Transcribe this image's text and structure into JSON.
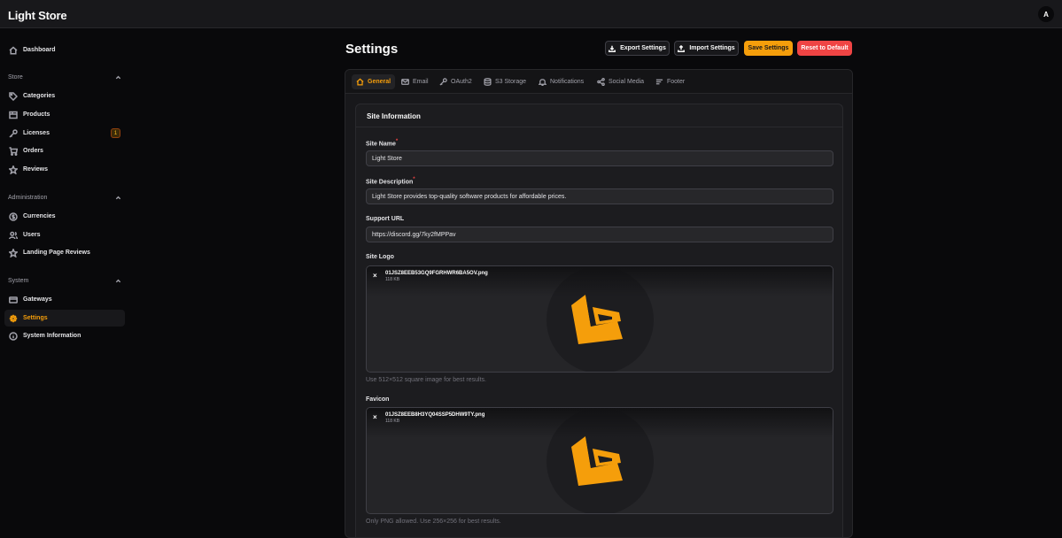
{
  "app": {
    "title": "Light Store",
    "avatar_initial": "A"
  },
  "sidebar": {
    "dashboard": "Dashboard",
    "groups": {
      "store": "Store",
      "administration": "Administration",
      "system": "System"
    },
    "items": {
      "categories": "Categories",
      "products": "Products",
      "licenses": "Licenses",
      "licenses_badge": "1",
      "orders": "Orders",
      "reviews": "Reviews",
      "currencies": "Currencies",
      "users": "Users",
      "landing_reviews": "Landing Page Reviews",
      "gateways": "Gateways",
      "settings": "Settings",
      "system_info": "System Information"
    }
  },
  "header": {
    "title": "Settings",
    "export": "Export Settings",
    "import": "Import Settings",
    "save": "Save Settings",
    "reset": "Reset to Default"
  },
  "tabs": [
    "General",
    "Email",
    "OAuth2",
    "S3 Storage",
    "Notifications",
    "Social Media",
    "Footer"
  ],
  "section": {
    "title": "Site Information",
    "site_name_label": "Site Name",
    "site_name_value": "Light Store",
    "site_desc_label": "Site Description",
    "site_desc_value": "Light Store provides top-quality software products for affordable prices.",
    "support_label": "Support URL",
    "support_value": "https://discord.gg/7ky2fMPPav",
    "logo_label": "Site Logo",
    "logo_file": "01JSZ8EEB53GQ9FGRHWR6BA5OV.png",
    "logo_size": "118 KB",
    "logo_hint": "Use 512×512 square image for best results.",
    "favicon_label": "Favicon",
    "favicon_file": "01JSZ8EEB8H3YQ04SSP5DHW9TY.png",
    "favicon_size": "118 KB",
    "favicon_hint": "Only PNG allowed. Use 256×256 for best results.",
    "required_mark": "*",
    "remove_glyph": "×"
  },
  "colors": {
    "accent": "#f59e0b",
    "danger": "#ef4444",
    "background": "#09090b",
    "surface": "#18181b"
  }
}
